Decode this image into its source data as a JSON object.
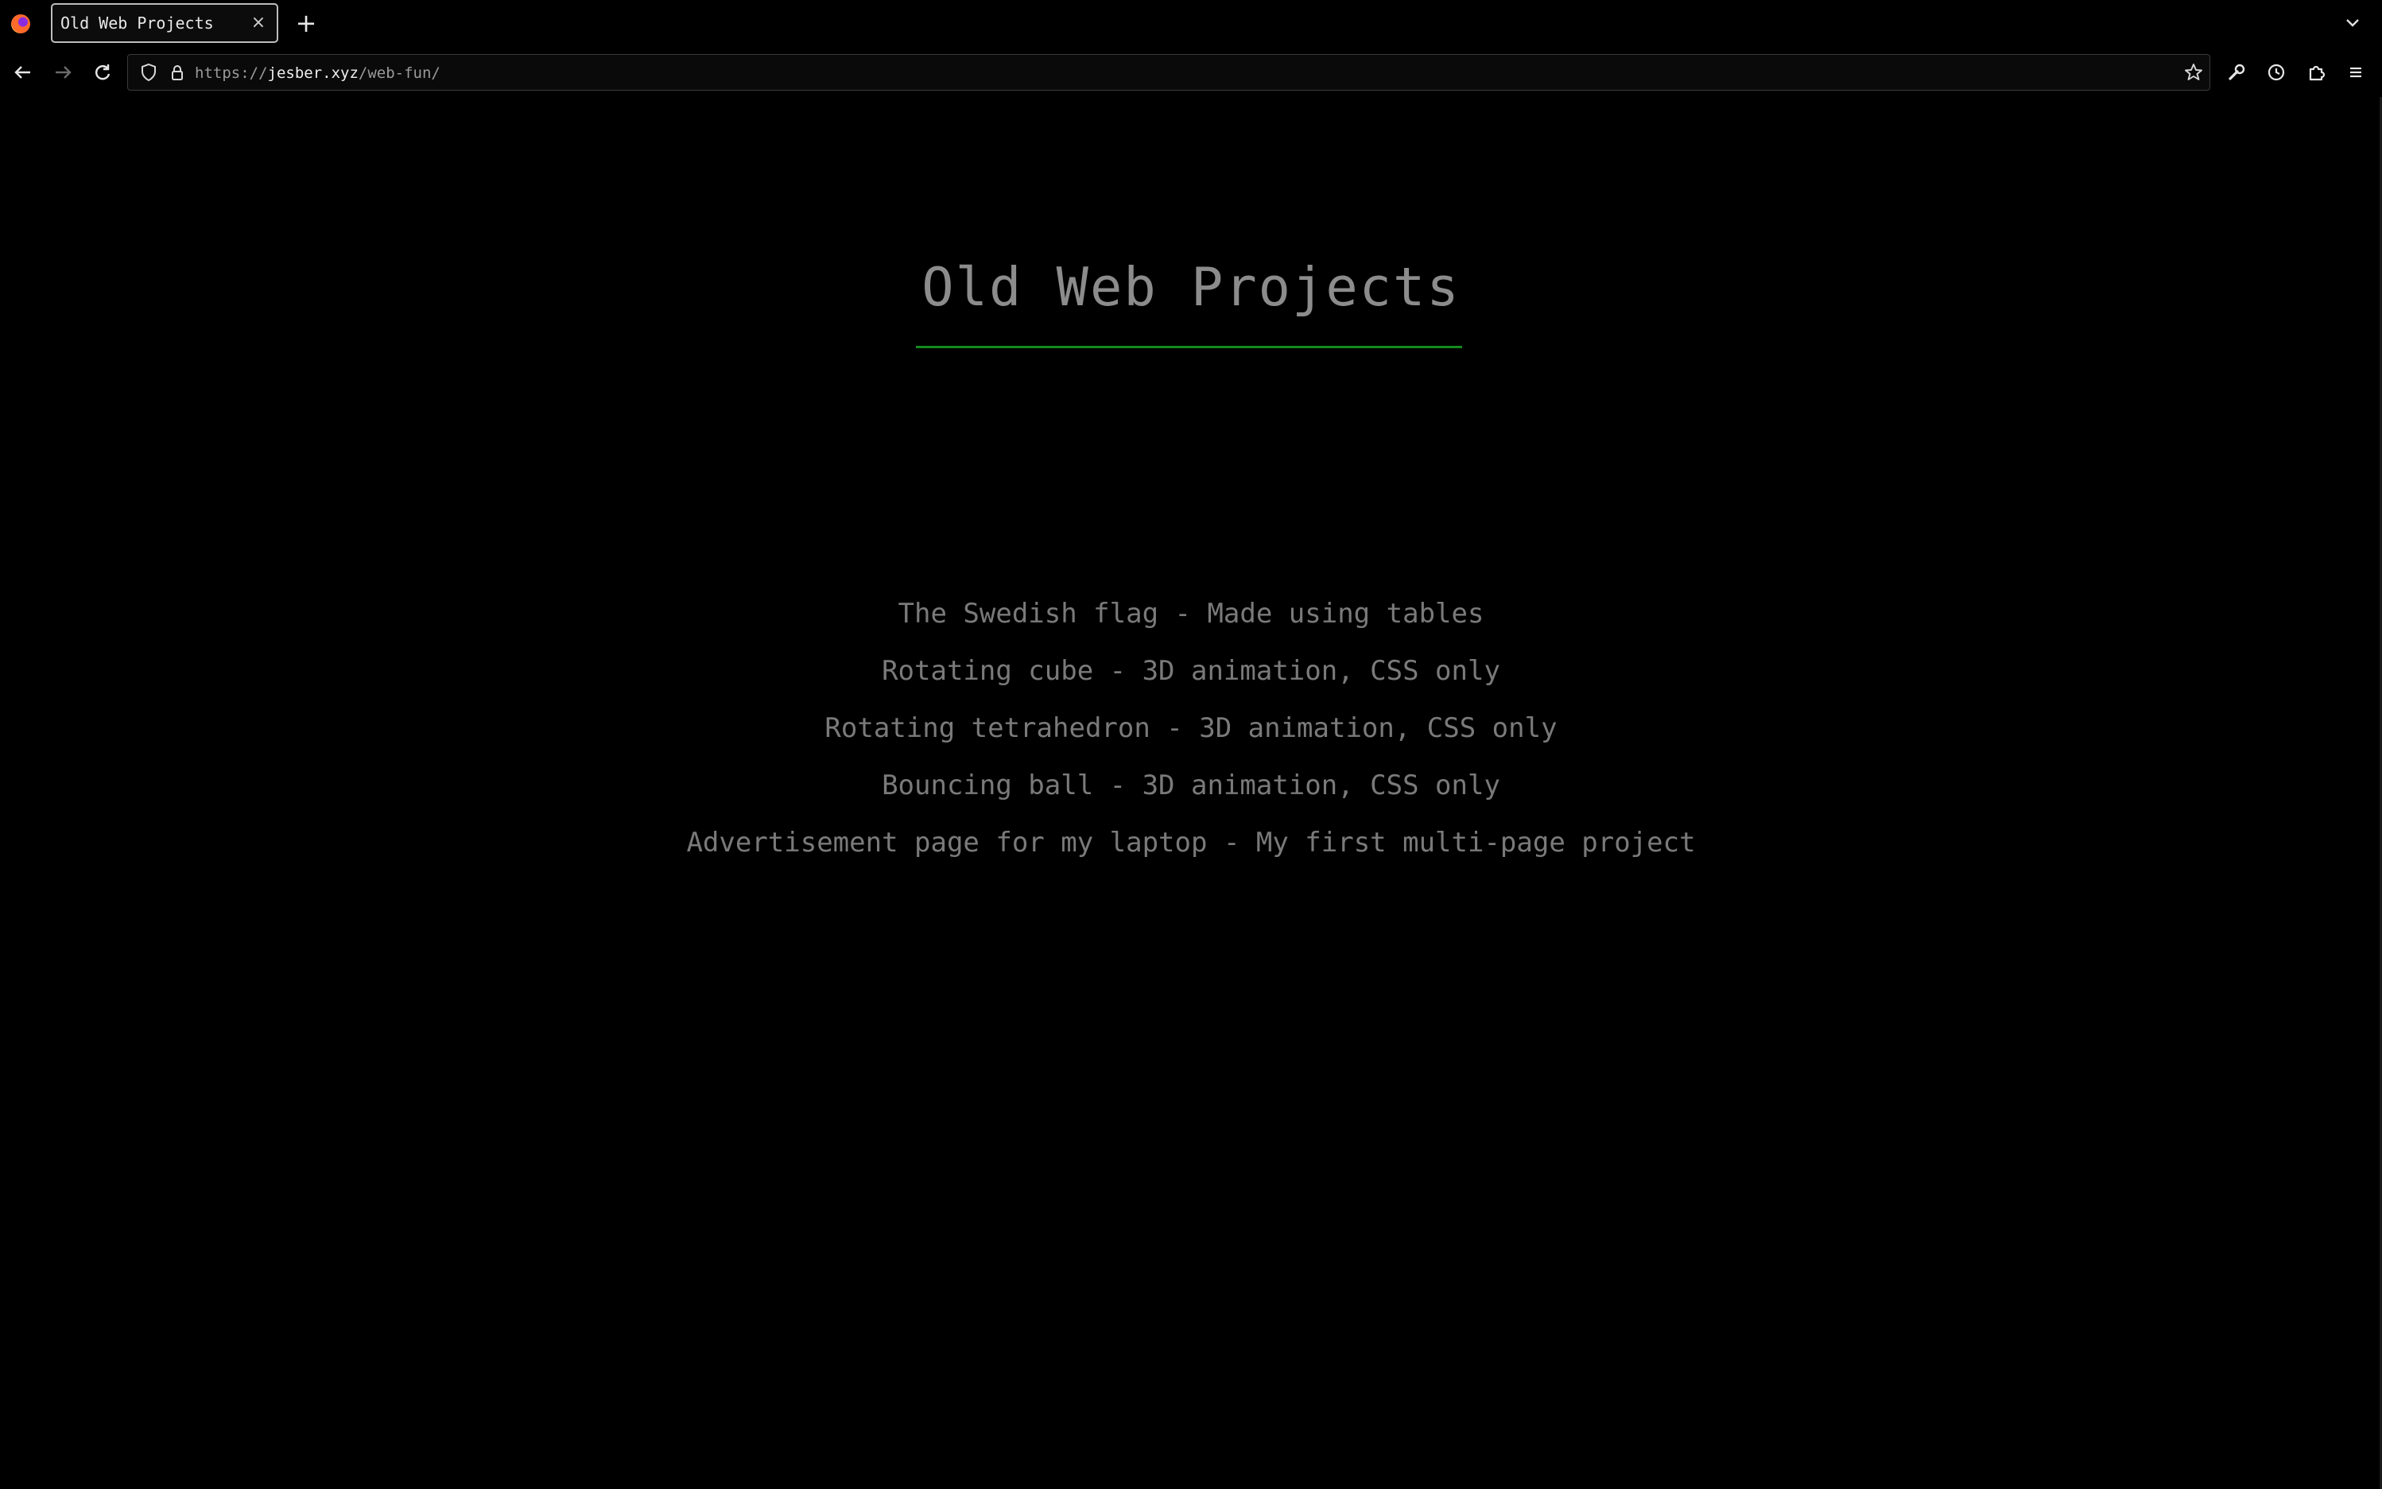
{
  "browser": {
    "tab": {
      "title": "Old Web Projects",
      "close_glyph": "×"
    },
    "new_tab_glyph": "+",
    "url": {
      "scheme": "https://",
      "host": "jesber.xyz",
      "path": "/web-fun/"
    },
    "icons": {
      "logo": "firefox-logo-icon",
      "back": "back-arrow-icon",
      "forward": "forward-arrow-icon",
      "reload": "reload-icon",
      "shield": "tracking-shield-icon",
      "lock": "lock-icon",
      "bookmark": "star-icon",
      "tools": "wrench-icon",
      "history": "clock-icon",
      "extensions": "puzzle-icon",
      "menu": "hamburger-menu-icon",
      "tab_list": "chevron-down-icon"
    }
  },
  "page": {
    "title": "Old Web Projects",
    "projects": [
      {
        "label": "The Swedish flag - Made using tables"
      },
      {
        "label": "Rotating cube - 3D animation, CSS only"
      },
      {
        "label": "Rotating tetrahedron - 3D animation, CSS only"
      },
      {
        "label": "Bouncing ball - 3D animation, CSS only"
      },
      {
        "label": "Advertisement page for my laptop - My first multi-page project"
      }
    ]
  },
  "colors": {
    "background": "#000000",
    "title_text": "#8c8c8c",
    "link_text": "#7a7a7a",
    "accent_rule": "#138b1e"
  }
}
